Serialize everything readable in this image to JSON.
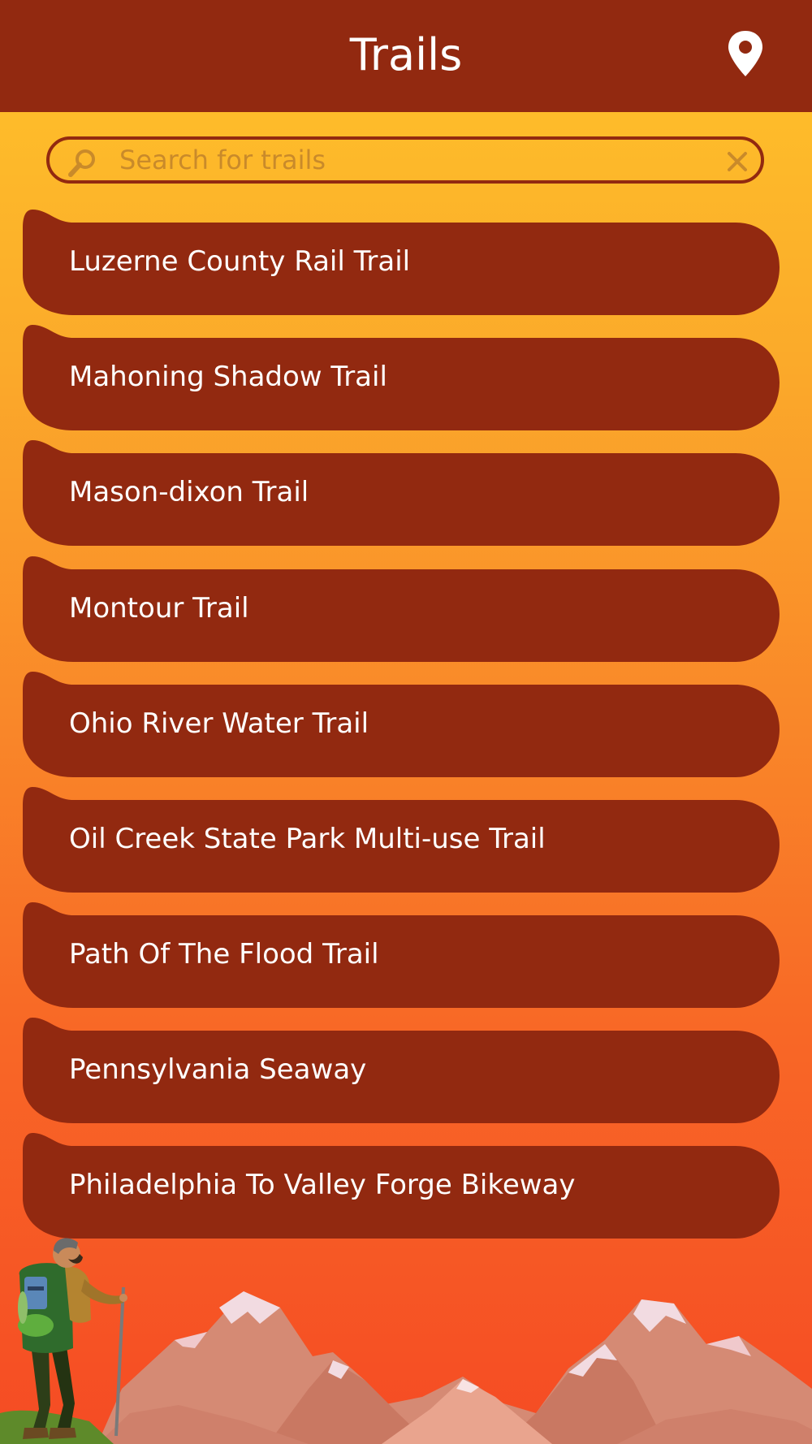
{
  "header": {
    "title": "Trails"
  },
  "search": {
    "placeholder": "Search for trails",
    "value": ""
  },
  "trails": [
    {
      "label": "Luzerne County Rail Trail"
    },
    {
      "label": "Mahoning Shadow Trail"
    },
    {
      "label": "Mason-dixon Trail"
    },
    {
      "label": "Montour Trail"
    },
    {
      "label": "Ohio River Water Trail"
    },
    {
      "label": "Oil Creek State Park Multi-use Trail"
    },
    {
      "label": "Path Of The Flood Trail"
    },
    {
      "label": "Pennsylvania Seaway"
    },
    {
      "label": "Philadelphia To Valley Forge Bikeway"
    }
  ],
  "icons": {
    "location": "map-pin-icon",
    "search": "magnifier-icon",
    "clear": "close-icon"
  },
  "colors": {
    "header": "#922910",
    "item": "#922910",
    "gradient_top": "#ffc42a",
    "gradient_bottom": "#f54b24"
  }
}
